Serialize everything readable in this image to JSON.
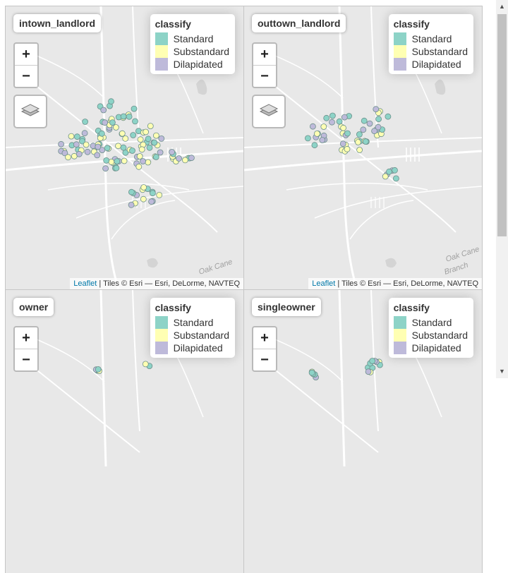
{
  "maps": [
    {
      "title": "intown_landlord",
      "legend_title": "classify",
      "legend_items": [
        "Standard",
        "Substandard",
        "Dilapidated"
      ],
      "attribution_link": "Leaflet",
      "attribution_text": " | Tiles © Esri — Esri, DeLorme, NAVTEQ",
      "labels": [
        "Oak Cane"
      ]
    },
    {
      "title": "outtown_landlord",
      "legend_title": "classify",
      "legend_items": [
        "Standard",
        "Substandard",
        "Dilapidated"
      ],
      "attribution_link": "Leaflet",
      "attribution_text": " | Tiles © Esri — Esri, DeLorme, NAVTEQ",
      "labels": [
        "Oak Cane",
        "Branch"
      ]
    },
    {
      "title": "owner",
      "legend_title": "classify",
      "legend_items": [
        "Standard",
        "Substandard",
        "Dilapidated"
      ]
    },
    {
      "title": "singleowner",
      "legend_title": "classify",
      "legend_items": [
        "Standard",
        "Substandard",
        "Dilapidated"
      ]
    }
  ],
  "zoom": {
    "in": "+",
    "out": "−"
  },
  "colors": {
    "Standard": "#8dd3c7",
    "Substandard": "#ffffb3",
    "Dilapidated": "#bebada",
    "map_bg": "#e8e8e8",
    "road": "#ffffff"
  },
  "icons": {
    "layers": "layers-icon",
    "scroll_up": "▲",
    "scroll_down": "▼"
  }
}
